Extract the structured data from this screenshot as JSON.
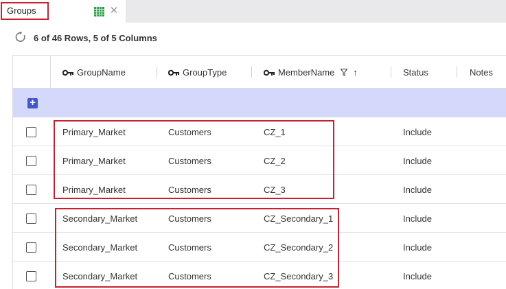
{
  "tab": {
    "title": "Groups",
    "grid_icon": "grid-icon",
    "close_icon": "close-icon",
    "close_glyph": "✕"
  },
  "status": {
    "row_count": "6 of 46 Rows, 5 of 5 Columns",
    "refresh_icon": "refresh-icon"
  },
  "table": {
    "columns": [
      {
        "label": "GroupName",
        "key": true
      },
      {
        "label": "GroupType",
        "key": true
      },
      {
        "label": "MemberName",
        "key": true,
        "filter": true,
        "sort": "ascending"
      },
      {
        "label": "Status",
        "key": false
      },
      {
        "label": "Notes",
        "key": false
      }
    ],
    "sort_glyph": "↑",
    "add_row_glyph": "+",
    "rows": [
      {
        "group": "Primary_Market",
        "type": "Customers",
        "member": "CZ_1",
        "status": "Include"
      },
      {
        "group": "Primary_Market",
        "type": "Customers",
        "member": "CZ_2",
        "status": "Include"
      },
      {
        "group": "Primary_Market",
        "type": "Customers",
        "member": "CZ_3",
        "status": "Include"
      },
      {
        "group": "Secondary_Market",
        "type": "Customers",
        "member": "CZ_Secondary_1",
        "status": "Include"
      },
      {
        "group": "Secondary_Market",
        "type": "Customers",
        "member": "CZ_Secondary_2",
        "status": "Include"
      },
      {
        "group": "Secondary_Market",
        "type": "Customers",
        "member": "CZ_Secondary_3",
        "status": "Include"
      }
    ]
  },
  "colors": {
    "highlight": "#c8202f",
    "add_row_band": "#d4d8fa",
    "add_button": "#4557c8",
    "grid_icon": "#2e9e48"
  }
}
